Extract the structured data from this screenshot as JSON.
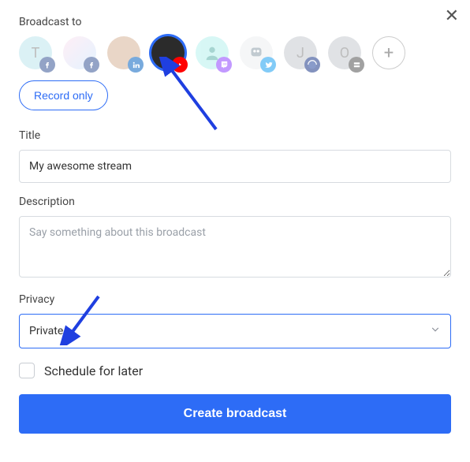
{
  "header": {
    "label": "Broadcast to"
  },
  "destinations": [
    {
      "name": "facebook-profile-1",
      "initial": "T",
      "badge": "facebook"
    },
    {
      "name": "facebook-profile-2",
      "initial": "",
      "badge": "facebook"
    },
    {
      "name": "linkedin-profile",
      "initial": "",
      "badge": "linkedin"
    },
    {
      "name": "youtube-profile",
      "initial": "",
      "badge": "youtube",
      "selected": true
    },
    {
      "name": "twitch-profile",
      "initial": "",
      "badge": "twitch"
    },
    {
      "name": "twitter-profile",
      "initial": "",
      "badge": "twitter"
    },
    {
      "name": "mixer-profile",
      "initial": "J",
      "badge": "mixer"
    },
    {
      "name": "custom-rtmp",
      "initial": "O",
      "badge": "custom"
    }
  ],
  "record_btn": "Record only",
  "title": {
    "label": "Title",
    "value": "My awesome stream"
  },
  "description": {
    "label": "Description",
    "placeholder": "Say something about this broadcast",
    "value": ""
  },
  "privacy": {
    "label": "Privacy",
    "selected": "Private"
  },
  "schedule": {
    "label": "Schedule for later",
    "checked": false
  },
  "submit": "Create broadcast",
  "colors": {
    "accent": "#2d6cf6"
  }
}
